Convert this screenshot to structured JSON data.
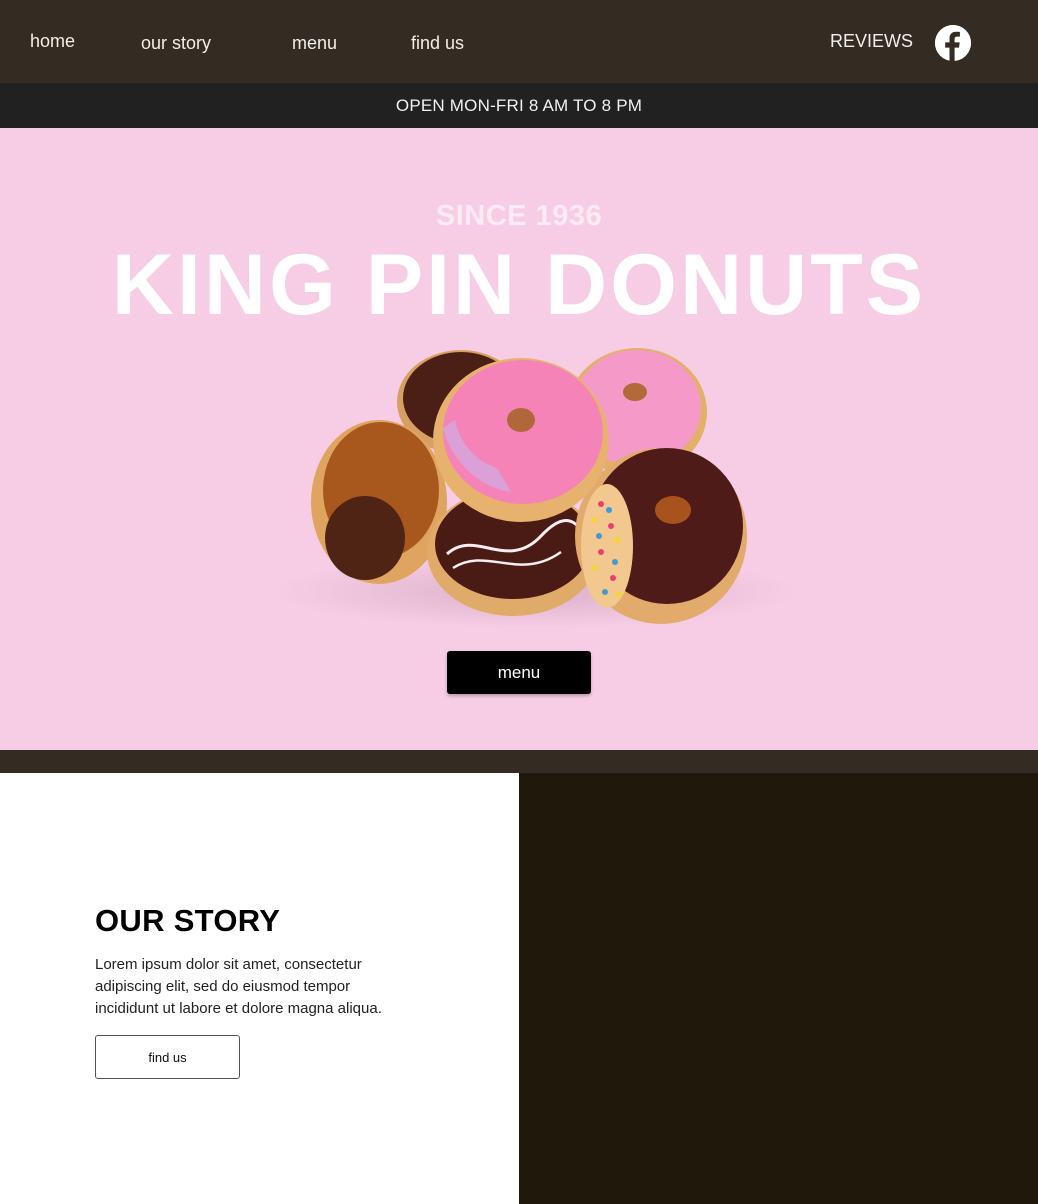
{
  "nav": {
    "home": "home",
    "our_story": "our story",
    "menu": "menu",
    "find_us": "find us",
    "reviews": "REVIEWS",
    "social_icon": "facebook-icon"
  },
  "hours_banner": "OPEN MON-FRI 8 AM TO 8 PM",
  "hero": {
    "since": "SINCE 1936",
    "brand": "KING PIN DONUTS",
    "image": "donuts-image",
    "menu_button": "menu"
  },
  "story": {
    "title": "OUR STORY",
    "text": "Lorem ipsum dolor sit amet, consectetur adipiscing elit, sed do eiusmod tempor incididunt ut labore et dolore magna aliqua.",
    "button": "find us"
  },
  "colors": {
    "nav_bg": "#342c22",
    "banner_bg": "#212121",
    "hero_bg": "#f6cde5",
    "dark_panel": "#21180c",
    "button_bg": "#000000"
  }
}
